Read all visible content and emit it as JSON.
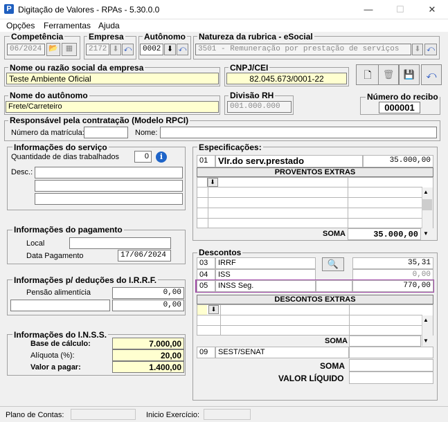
{
  "window": {
    "title": "Digitação de Valores - RPAs - 5.30.0.0",
    "app_icon": "P",
    "minimize": "—",
    "maximize": "☐",
    "close": "✕"
  },
  "menu": [
    "Opções",
    "Ferramentas",
    "Ajuda"
  ],
  "competencia": {
    "label": "Competência",
    "value": "06/2024"
  },
  "empresa": {
    "label": "Empresa",
    "value": "2172"
  },
  "autonomo": {
    "label": "Autônomo",
    "value": "0002"
  },
  "natureza": {
    "label": "Natureza da rubrica - eSocial",
    "value": "3501 - Remuneração por prestação de serviços"
  },
  "nome_empresa": {
    "label": "Nome ou razão social da empresa",
    "value": "Teste Ambiente Oficial"
  },
  "cnpj": {
    "label": "CNPJ/CEI",
    "value": "82.045.673/0001-22"
  },
  "nome_autonomo": {
    "label": "Nome do autônomo",
    "value": "Frete/Carreteiro"
  },
  "divisao": {
    "label": "Divisão RH",
    "value": "001.000.000"
  },
  "recibo": {
    "label": "Número do recibo",
    "value": "000001"
  },
  "responsavel": {
    "label": "Responsável pela contratação (Modelo RPCI)",
    "matricula_label": "Número da matrícula:",
    "nome_label": "Nome:"
  },
  "servico": {
    "label": "Informações do serviço",
    "dias_label": "Quantidade de dias trabalhados",
    "dias_value": "0",
    "desc_label": "Desc.:"
  },
  "pagamento": {
    "label": "Informações do pagamento",
    "local_label": "Local",
    "data_label": "Data Pagamento",
    "data_value": "17/06/2024"
  },
  "irrf": {
    "label": "Informações p/ deduções do I.R.R.F.",
    "pensao_label": "Pensão alimentícia",
    "pensao_value": "0,00",
    "outro_value": "0,00"
  },
  "inss": {
    "label": "Informações do I.N.S.S.",
    "base_label": "Base de cálculo:",
    "base_value": "7.000,00",
    "aliquota_label": "Alíquota (%):",
    "aliquota_value": "20,00",
    "valor_label": "Valor a pagar:",
    "valor_value": "1.400,00"
  },
  "especificacoes": {
    "label": "Especificações:",
    "code": "01",
    "desc": "Vlr.do serv.prestado",
    "value": "35.000,00",
    "extras_label": "PROVENTOS EXTRAS",
    "soma_label": "SOMA",
    "soma_value": "35.000,00"
  },
  "descontos": {
    "label": "Descontos",
    "rows": [
      {
        "code": "03",
        "desc": "IRRF",
        "value": "35,31"
      },
      {
        "code": "04",
        "desc": "ISS",
        "value": "0,00"
      },
      {
        "code": "05",
        "desc": "INSS Seg.",
        "value": "770,00"
      }
    ],
    "extras_label": "DESCONTOS EXTRAS",
    "soma_label": "SOMA",
    "sest_code": "09",
    "sest_desc": "SEST/SENAT"
  },
  "totais": {
    "soma_label": "SOMA",
    "liquido_label": "VALOR LÍQUIDO"
  },
  "status": {
    "plano_label": "Plano de Contas:",
    "inicio_label": "Inicio Exercício:"
  }
}
